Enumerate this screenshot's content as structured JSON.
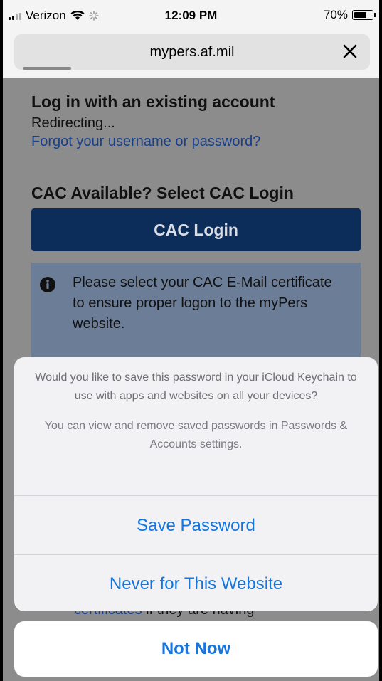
{
  "status_bar": {
    "carrier": "Verizon",
    "time": "12:09 PM",
    "battery": "70%",
    "battery_level": 0.7
  },
  "url_bar": {
    "url": "mypers.af.mil",
    "close_icon": "close-icon"
  },
  "page": {
    "login_heading": "Log in with an existing account",
    "redirecting": "Redirecting...",
    "forgot_link": "Forgot your username or password?",
    "cac_heading": "CAC Available? Select CAC Login",
    "cac_button": "CAC Login",
    "info_text": "Please select your CAC E-Mail certificate to ensure proper logon to the myPers website.",
    "peek_link": "certificates",
    "peek_text": " if they are having"
  },
  "sheet": {
    "question": "Would you like to save this password in your iCloud Keychain to use with apps and websites on all your devices?",
    "note": "You can view and remove saved passwords in Passwords & Accounts settings.",
    "save_button": "Save Password",
    "never_button": "Never for This Website",
    "cancel_button": "Not Now"
  },
  "colors": {
    "action_blue": "#1676e0",
    "cac_button_bg": "#0c2d5a",
    "info_box_bg": "#6b7d97"
  }
}
